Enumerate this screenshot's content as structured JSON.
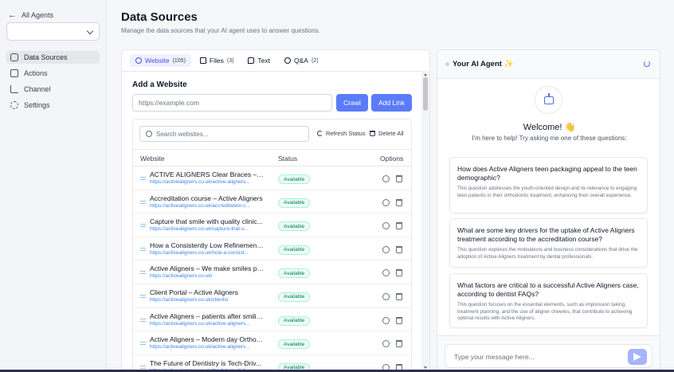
{
  "sidebar": {
    "back_label": "All Agents",
    "back_icon": "arrow-left-icon",
    "select_value": "",
    "items": [
      {
        "label": "Data Sources",
        "icon": "database-icon",
        "active": true
      },
      {
        "label": "Actions",
        "icon": "actions-icon",
        "active": false
      },
      {
        "label": "Channel",
        "icon": "channel-icon",
        "active": false
      },
      {
        "label": "Settings",
        "icon": "gear-icon",
        "active": false
      }
    ]
  },
  "page": {
    "title": "Data Sources",
    "subtitle": "Manage the data sources that your AI agent uses to answer questions."
  },
  "tabs": [
    {
      "label": "Website",
      "count": "(105)",
      "icon": "globe-icon",
      "active": true
    },
    {
      "label": "Files",
      "count": "(3)",
      "icon": "file-icon",
      "active": false
    },
    {
      "label": "Text",
      "count": "",
      "icon": "text-icon",
      "active": false
    },
    {
      "label": "Q&A",
      "count": "(2)",
      "icon": "question-icon",
      "active": false
    }
  ],
  "add_website": {
    "title": "Add a Website",
    "placeholder": "https://example.com",
    "crawl_label": "Crawl",
    "add_label": "Add Link"
  },
  "table": {
    "search_placeholder": "Search websites...",
    "refresh_label": "Refresh Status",
    "delete_label": "Delete All",
    "headers": {
      "website": "Website",
      "status": "Status",
      "options": "Options"
    },
    "rows": [
      {
        "title": "ACTIVE ALIGNERS Clear Braces – gu...",
        "url": "https://activealigners.co.uk/active-aligners...",
        "status": "Available"
      },
      {
        "title": "Accreditation course – Active Aligners",
        "url": "https://activealigners.co.uk/accreditation-c...",
        "status": "Available"
      },
      {
        "title": "Capture that smile with quality clinic...",
        "url": "https://activealigners.co.uk/capture-that-s...",
        "status": "Available"
      },
      {
        "title": "How a Consistently Low Refinement ...",
        "url": "https://activealigners.co.uk/how-a-consist...",
        "status": "Available"
      },
      {
        "title": "Active Aligners – We make smiles pe...",
        "url": "https://activealigners.co.uk/",
        "status": "Available"
      },
      {
        "title": "Client Portal – Active Aligners",
        "url": "https://activealigners.co.uk/clients/",
        "status": "Available"
      },
      {
        "title": "Active Aligners – patients after smilin...",
        "url": "https://activealigners.co.uk/active-aligners...",
        "status": "Available"
      },
      {
        "title": "Active Aligners – Modern day Orthod...",
        "url": "https://activealigners.co.uk/active-aligners...",
        "status": "Available"
      },
      {
        "title": "The Future of Dentistry is Tech-Driv...",
        "url": "https://activealigners.co.uk/the-future-of-d...",
        "status": "Available"
      }
    ]
  },
  "chat": {
    "title": "Your AI Agent ✨",
    "welcome": "Welcome! 👋",
    "help_text": "I'm here to help! Try asking me one of these questions:",
    "questions": [
      {
        "q": "How does Active Aligners teen packaging appeal to the teen demographic?",
        "desc": "This question addresses the youth-oriented design and its relevance to engaging teen patients in their orthodontic treatment, enhancing their overall experience."
      },
      {
        "q": "What are some key drivers for the uptake of Active Aligners treatment according to the accreditation course?",
        "desc": "This question explores the motivations and business considerations that drive the adoption of Active Aligners treatment by dental professionals."
      },
      {
        "q": "What factors are critical to a successful Active Aligners case, according to dentist FAQs?",
        "desc": "This question focuses on the essential elements, such as impression taking, treatment planning, and the use of aligner chewies, that contribute to achieving optimal results with Active Aligners."
      }
    ],
    "input_placeholder": "Type your message here..."
  },
  "colors": {
    "accent": "#5b7cfa",
    "badge_green": "#047857",
    "link_blue": "#3b82f6"
  }
}
